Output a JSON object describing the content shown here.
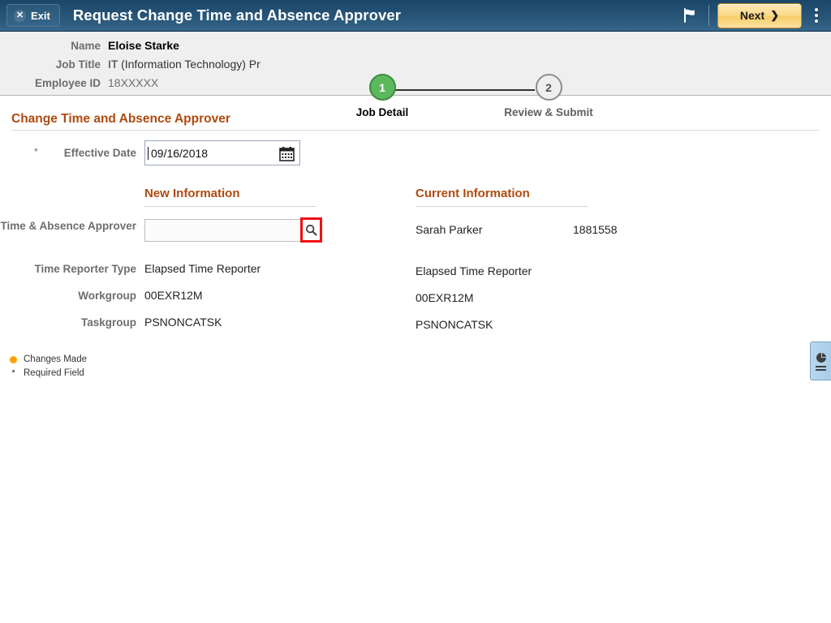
{
  "titlebar": {
    "exit_label": "Exit",
    "exit_icon": "close-x-icon",
    "title": "Request Change Time and Absence Approver",
    "flag_icon": "flag-icon",
    "next_label": "Next",
    "next_chevron": "❯",
    "kebab_icon": "more-actions-icon"
  },
  "employee": {
    "name_label": "Name",
    "name_value": "Eloise Starke",
    "job_title_label": "Job Title",
    "job_title_value": "IT (Information Technology) Pr",
    "employee_id_label": "Employee ID",
    "employee_id_value": "18XXXXX"
  },
  "steps": [
    {
      "number": "1",
      "label": "Job Detail",
      "state": "active"
    },
    {
      "number": "2",
      "label": "Review & Submit",
      "state": "idle"
    }
  ],
  "page": {
    "title": "Change Time and Absence Approver"
  },
  "effective_date": {
    "label": "Effective  Date",
    "required_marker": "*",
    "value": "09/16/2018",
    "calendar_icon": "calendar-icon"
  },
  "columns": {
    "new_information": "New Information",
    "current_information": "Current Information"
  },
  "fields": [
    {
      "label": "Time & Absence Approver",
      "new_value": "",
      "current_value": "Sarah Parker",
      "current_id": "1881558",
      "lookup_icon": "magnifier-search-icon"
    },
    {
      "label": "Time Reporter Type",
      "new_value": "Elapsed Time Reporter",
      "current_value": "Elapsed Time Reporter",
      "current_id": ""
    },
    {
      "label": "Workgroup",
      "new_value": "00EXR12M",
      "current_value": "00EXR12M",
      "current_id": ""
    },
    {
      "label": "Taskgroup",
      "new_value": "PSNONCATSK",
      "current_value": "PSNONCATSK",
      "current_id": ""
    }
  ],
  "legend": {
    "changes_made": "Changes Made",
    "required_field": "Required Field",
    "required_marker": "*",
    "changes_dot_color": "#ffa000"
  },
  "side_panel": {
    "icon": "pie-chart-list-icon"
  },
  "colors": {
    "titlebar_top": "#1b4767",
    "titlebar_bottom": "#37688d",
    "accent_orange": "#b04a0f",
    "next_button": "#fbd987",
    "step_active": "#5cb85c",
    "highlight_red": "#ee1111"
  }
}
